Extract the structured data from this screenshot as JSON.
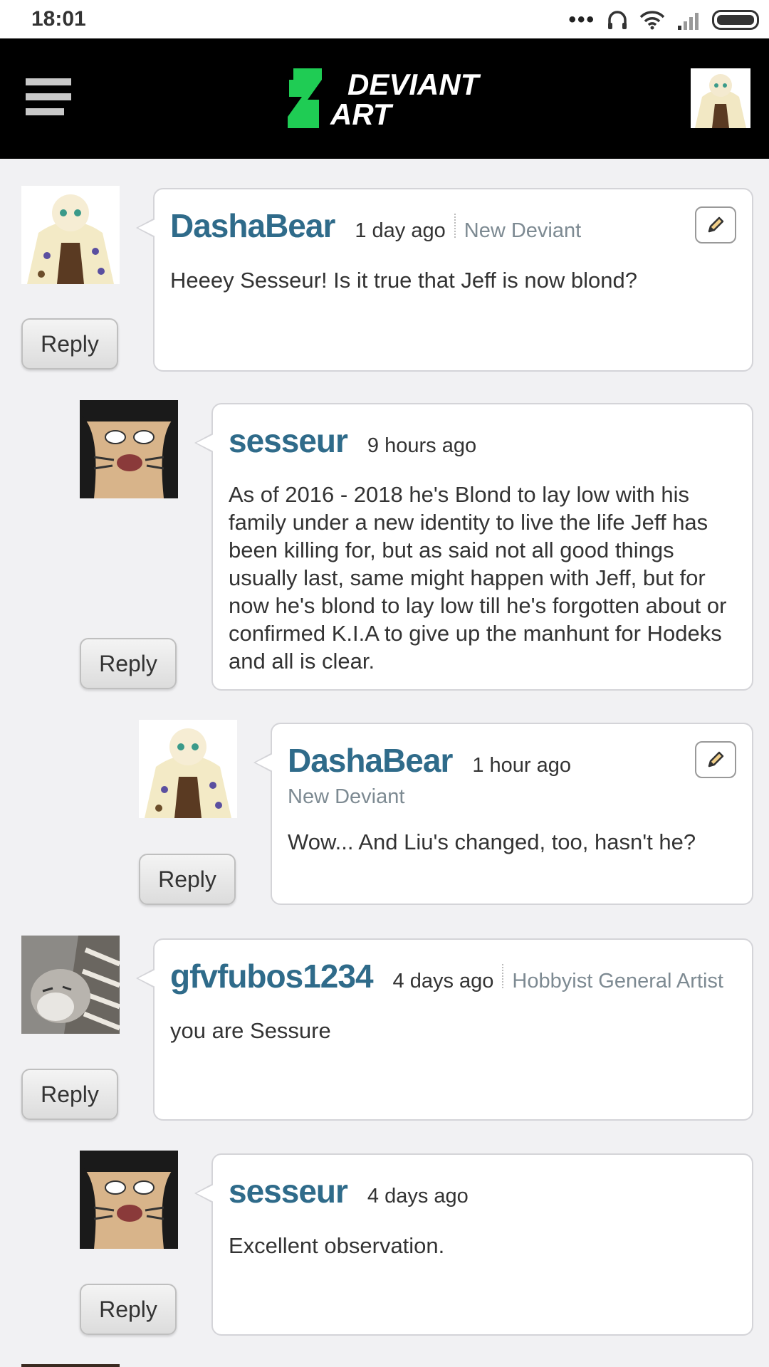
{
  "status_bar": {
    "time": "18:01"
  },
  "header": {
    "logo_line1": "DEVIANT",
    "logo_line2": "ART"
  },
  "comments": [
    {
      "username": "DashaBear",
      "time": "1 day ago",
      "rank": "New Deviant",
      "text": "Heeey Sesseur! Is it true that Jeff is now blond?",
      "reply": "Reply"
    },
    {
      "username": "sesseur",
      "time": "9 hours ago",
      "text": "As of 2016 - 2018 he's Blond to lay low with his family under a new identity to live the life Jeff has been killing for, but as said not all good things usually last, same might happen with Jeff, but for now he's blond to lay low till he's forgotten about or confirmed K.I.A to give up the manhunt for Hodeks and all is clear.",
      "reply": "Reply"
    },
    {
      "username": "DashaBear",
      "time": "1 hour ago",
      "rank": "New Deviant",
      "text": "Wow... And Liu's changed, too, hasn't he?",
      "reply": "Reply"
    },
    {
      "username": "gfvfubos1234",
      "time": "4 days ago",
      "rank": "Hobbyist General Artist",
      "text": "you are Sessure",
      "reply": "Reply"
    },
    {
      "username": "sesseur",
      "time": "4 days ago",
      "text": "Excellent observation.",
      "reply": "Reply"
    }
  ]
}
